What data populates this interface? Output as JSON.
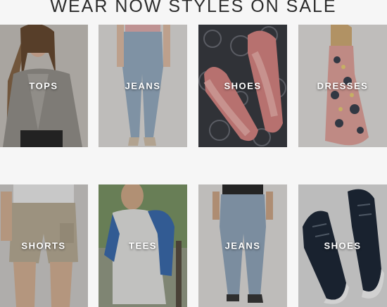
{
  "heading": "WEAR NOW STYLES ON SALE",
  "tiles_row1": [
    {
      "label": "TOPS"
    },
    {
      "label": "JEANS"
    },
    {
      "label": "SHOES"
    },
    {
      "label": "DRESSES"
    }
  ],
  "tiles_row2": [
    {
      "label": "SHORTS"
    },
    {
      "label": "TEES"
    },
    {
      "label": "JEANS"
    },
    {
      "label": "SHOES"
    }
  ]
}
